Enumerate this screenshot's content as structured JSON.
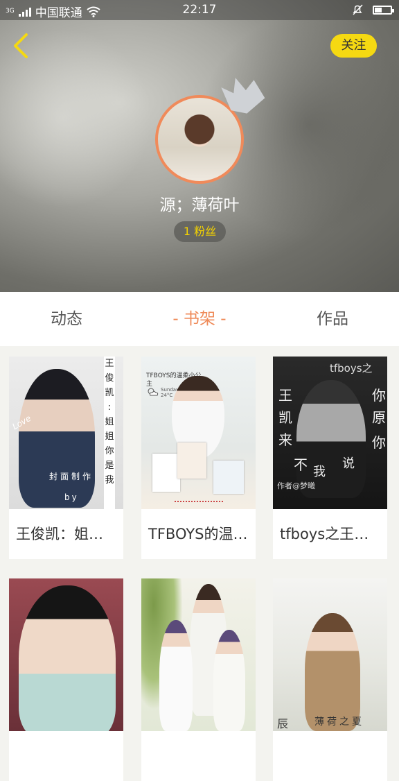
{
  "status": {
    "network": "3G",
    "carrier": "中国联通",
    "time": "22:17",
    "icons": [
      "signal-icon",
      "wifi-icon",
      "mute-icon",
      "battery-icon"
    ],
    "battery_level": 0.45
  },
  "header": {
    "back_icon": "chevron-left-icon",
    "follow_label": "关注",
    "username": "源；薄荷叶",
    "fans_label": "1 粉丝",
    "accent": "#f5d912",
    "avatar_ring": "#f08a5a"
  },
  "tabs": [
    {
      "label": "动态"
    },
    {
      "label": "- 书架 -"
    },
    {
      "label": "作品"
    }
  ],
  "active_tab": 1,
  "books": [
    {
      "title": "王俊凯：姐姐你是我的",
      "cover_text": [
        "王",
        "俊",
        "凯",
        ":",
        "姐",
        "姐",
        "你",
        "是",
        "我"
      ],
      "cover_caption": "封面制作",
      "cover_by": "by",
      "cover_love": "Love"
    },
    {
      "title": "TFBOYS的温柔小公主",
      "cover_text": [
        "TFBOYS的温柔小公",
        "主"
      ],
      "cover_weather": "Sunday 24°C"
    },
    {
      "title": "tfboys之王俊凯你好",
      "cover_text": [
        "tfboys之",
        "王",
        "凯",
        "来",
        "不",
        "我",
        "你",
        "原",
        "你",
        "说"
      ],
      "cover_caption": "作者@梦曦"
    },
    {
      "title": "",
      "cover_text": []
    },
    {
      "title": "",
      "cover_text": []
    },
    {
      "title": "",
      "cover_text": [
        "辰",
        "薄荷之夏"
      ]
    }
  ]
}
